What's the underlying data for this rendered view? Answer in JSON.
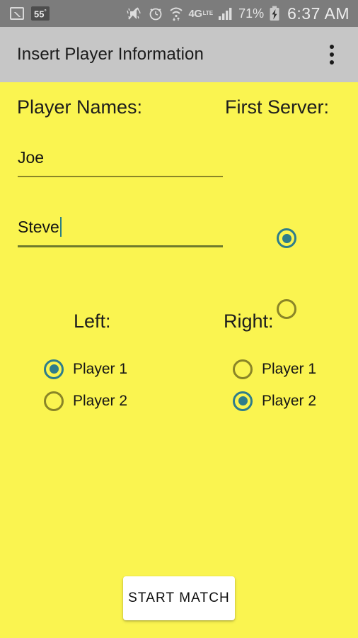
{
  "status_bar": {
    "photo_icon": "photo-icon",
    "temperature": "55",
    "temperature_unit": "°",
    "mute_icon": "volume-mute-vibrate-icon",
    "alarm_icon": "alarm-clock-icon",
    "wifi_icon": "wifi-icon",
    "network_label": "4G",
    "network_suffix": "LTE",
    "signal_icon": "cellular-signal-icon",
    "battery_percent": "71%",
    "battery_icon": "battery-charging-icon",
    "time": "6:37 AM",
    "background_color": "#7c7c7c",
    "text_color": "#e4e4e4"
  },
  "app_bar": {
    "title": "Insert Player Information",
    "overflow_icon": "more-vertical-icon",
    "background_color": "#c6c6c6"
  },
  "content": {
    "background_color": "#FAF450",
    "headers": {
      "player_names": "Player Names:",
      "first_server": "First Server:"
    },
    "fields": [
      {
        "value": "Joe",
        "focused": false
      },
      {
        "value": "Steve",
        "focused": true
      }
    ],
    "first_server": {
      "options": [
        {
          "label": "",
          "checked": true
        },
        {
          "label": "",
          "checked": false
        }
      ]
    },
    "side_groups": [
      {
        "title": "Left:",
        "options": [
          {
            "label": "Player 1",
            "checked": true
          },
          {
            "label": "Player 2",
            "checked": false
          }
        ]
      },
      {
        "title": "Right:",
        "options": [
          {
            "label": "Player 1",
            "checked": false
          },
          {
            "label": "Player 2",
            "checked": true
          }
        ]
      }
    ],
    "start_button": "START MATCH",
    "accent_color": "#2e7d8a",
    "radio_unchecked_color": "#8a8527"
  }
}
